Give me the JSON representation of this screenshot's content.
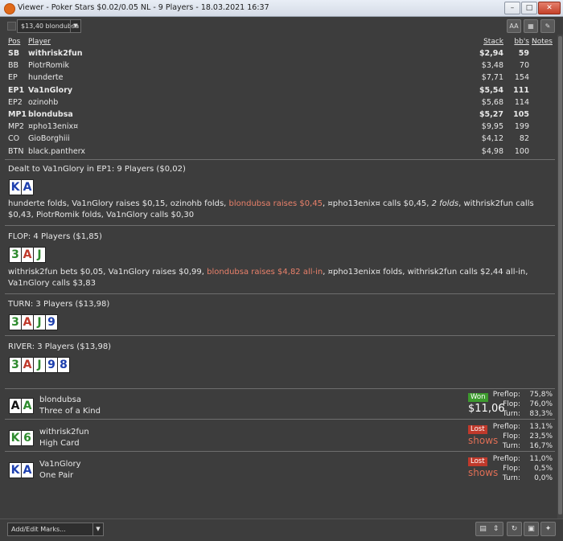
{
  "window": {
    "title": "Viewer - Poker Stars $0.02/0.05 NL - 9 Players - 18.03.2021 16:37",
    "minimize_glyph": "–",
    "maximize_glyph": "□",
    "close_glyph": "✕"
  },
  "toolbar": {
    "player_select": "$13,40 blondubsa",
    "dropdown_glyph": "▼",
    "btn_font_glyph": "AA",
    "btn_grid_glyph": "▦",
    "btn_edit_glyph": "✎"
  },
  "table": {
    "headers": {
      "pos": "Pos",
      "player": "Player",
      "stack": "Stack",
      "bbs": "bb's",
      "notes": "Notes"
    },
    "rows": [
      {
        "pos": "SB",
        "player": "withrisk2fun",
        "stack": "$2,94",
        "bbs": "59",
        "bold": true
      },
      {
        "pos": "BB",
        "player": "PiotrRomik",
        "stack": "$3,48",
        "bbs": "70",
        "bold": false
      },
      {
        "pos": "EP",
        "player": "hunderte",
        "stack": "$7,71",
        "bbs": "154",
        "bold": false
      },
      {
        "pos": "EP1",
        "player": "Va1nGlory",
        "stack": "$5,54",
        "bbs": "111",
        "bold": true
      },
      {
        "pos": "EP2",
        "player": "ozinohb",
        "stack": "$5,68",
        "bbs": "114",
        "bold": false
      },
      {
        "pos": "MP1",
        "player": "blondubsa",
        "stack": "$5,27",
        "bbs": "105",
        "bold": true
      },
      {
        "pos": "MP2",
        "player": "¤pho13enix¤",
        "stack": "$9,95",
        "bbs": "199",
        "bold": false
      },
      {
        "pos": "CO",
        "player": "GioBorghiii",
        "stack": "$4,12",
        "bbs": "82",
        "bold": false
      },
      {
        "pos": "BTN",
        "player": "black.pantherx",
        "stack": "$4,98",
        "bbs": "100",
        "bold": false
      }
    ]
  },
  "preflop": {
    "heading": "Dealt to Va1nGlory in EP1: 9 Players ($0,02)",
    "cards": [
      {
        "rank": "K",
        "color": "#1d3fae"
      },
      {
        "rank": "A",
        "color": "#1d3fae"
      }
    ],
    "actions": [
      {
        "text": "hunderte folds, Va1nGlory raises $0,15, ozinohb folds, ",
        "style": ""
      },
      {
        "text": "blondubsa raises $0,45",
        "style": "hl"
      },
      {
        "text": ", ¤pho13enix¤ calls $0,45, ",
        "style": ""
      },
      {
        "text": "2 folds",
        "style": "it"
      },
      {
        "text": ", withrisk2fun calls $0,43, PiotrRomik folds, Va1nGlory calls $0,30",
        "style": ""
      }
    ]
  },
  "flop": {
    "heading": "FLOP: 4 Players ($1,85)",
    "cards": [
      {
        "rank": "3",
        "color": "#2e8b2e"
      },
      {
        "rank": "A",
        "color": "#c0392b"
      },
      {
        "rank": "J",
        "color": "#2e8b2e"
      }
    ],
    "actions": [
      {
        "text": "withrisk2fun bets $0,05, Va1nGlory raises $0,99, ",
        "style": ""
      },
      {
        "text": "blondubsa raises $4,82 all-in",
        "style": "hl"
      },
      {
        "text": ", ¤pho13enix¤ folds, withrisk2fun calls $2,44 all-in, Va1nGlory calls $3,83",
        "style": ""
      }
    ]
  },
  "turn": {
    "heading": "TURN: 3 Players ($13,98)",
    "cards": [
      {
        "rank": "3",
        "color": "#2e8b2e"
      },
      {
        "rank": "A",
        "color": "#c0392b"
      },
      {
        "rank": "J",
        "color": "#2e8b2e"
      },
      {
        "rank": "9",
        "color": "#1d3fae"
      }
    ]
  },
  "river": {
    "heading": "RIVER: 3 Players ($13,98)",
    "cards": [
      {
        "rank": "3",
        "color": "#2e8b2e"
      },
      {
        "rank": "A",
        "color": "#c0392b"
      },
      {
        "rank": "J",
        "color": "#2e8b2e"
      },
      {
        "rank": "9",
        "color": "#1d3fae"
      },
      {
        "rank": "8",
        "color": "#1d3fae"
      }
    ]
  },
  "results": [
    {
      "player": "blondubsa",
      "hand": "Three of a Kind",
      "cards": [
        {
          "rank": "A",
          "color": "#111111"
        },
        {
          "rank": "A",
          "color": "#2e8b2e"
        }
      ],
      "badge": "Won",
      "badge_type": "won",
      "amount": "$11,06",
      "shows": "",
      "stats": [
        {
          "label": "Preflop:",
          "value": "75,8%"
        },
        {
          "label": "Flop:",
          "value": "76,0%"
        },
        {
          "label": "Turn:",
          "value": "83,3%"
        }
      ]
    },
    {
      "player": "withrisk2fun",
      "hand": "High Card",
      "cards": [
        {
          "rank": "K",
          "color": "#2e8b2e"
        },
        {
          "rank": "6",
          "color": "#2e8b2e"
        }
      ],
      "badge": "Lost",
      "badge_type": "lost",
      "amount": "",
      "shows": "shows",
      "stats": [
        {
          "label": "Preflop:",
          "value": "13,1%"
        },
        {
          "label": "Flop:",
          "value": "23,5%"
        },
        {
          "label": "Turn:",
          "value": "16,7%"
        }
      ]
    },
    {
      "player": "Va1nGlory",
      "hand": "One Pair",
      "cards": [
        {
          "rank": "K",
          "color": "#1d3fae"
        },
        {
          "rank": "A",
          "color": "#1d3fae"
        }
      ],
      "badge": "Lost",
      "badge_type": "lost",
      "amount": "",
      "shows": "shows",
      "stats": [
        {
          "label": "Preflop:",
          "value": "11,0%"
        },
        {
          "label": "Flop:",
          "value": "0,5%"
        },
        {
          "label": "Turn:",
          "value": "0,0%"
        }
      ]
    }
  ],
  "statusbar": {
    "marks_select": "Add/Edit Marks...",
    "dropdown_glyph": "▼",
    "calc_glyph": "▤",
    "updown_glyph": "⇕",
    "refresh_glyph": "↻",
    "save_glyph": "▣",
    "twitter_glyph": "✦"
  },
  "colors": {
    "background": "#3d3d3d",
    "highlight_action": "#e8806a",
    "won": "#3d9a2e",
    "lost": "#c0392b"
  }
}
